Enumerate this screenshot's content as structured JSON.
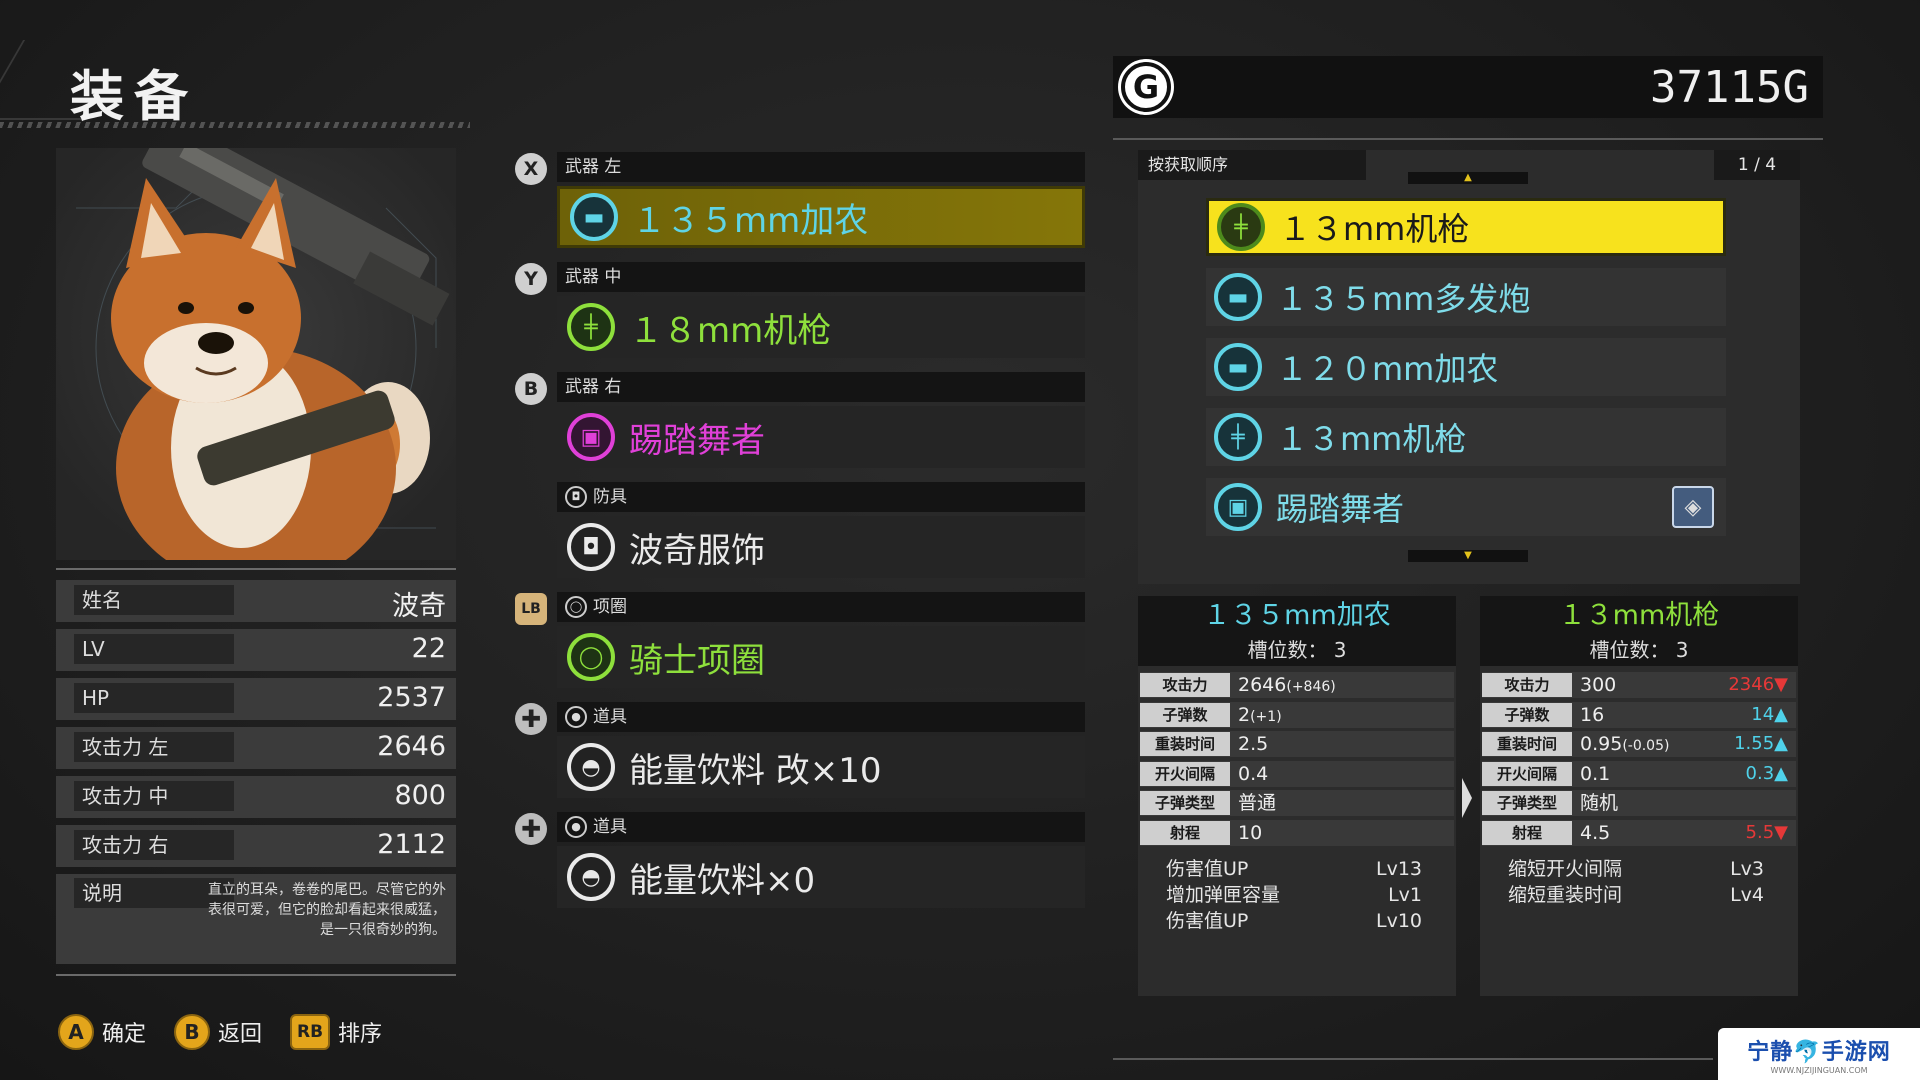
{
  "header": {
    "title": "装备"
  },
  "gold": {
    "amount": "37115G",
    "icon": "G"
  },
  "character": {
    "stats": [
      {
        "label": "姓名",
        "value": "波奇"
      },
      {
        "label": "LV",
        "value": "22"
      },
      {
        "label": "HP",
        "value": "2537"
      },
      {
        "label": "攻击力 左",
        "value": "2646"
      },
      {
        "label": "攻击力 中",
        "value": "800"
      },
      {
        "label": "攻击力 右",
        "value": "2112"
      }
    ],
    "description_label": "说明",
    "description": "直立的耳朵，卷卷的尾巴。尽管它的外表很可爱，但它的脸却看起来很威猛，是一只很奇妙的狗。"
  },
  "slots": [
    {
      "key": "X",
      "category": "武器 左",
      "item": "１３５mm加农",
      "icon": "cannon-icon",
      "color": "#5fd4e6"
    },
    {
      "key": "Y",
      "category": "武器 中",
      "item": "１８mm机枪",
      "icon": "machine-gun-icon",
      "color": "#8ee03c"
    },
    {
      "key": "B",
      "category": "武器 右",
      "item": "踢踏舞者",
      "icon": "tap-dancer-icon",
      "color": "#e040d8"
    },
    {
      "key": "",
      "category": "防具",
      "item": "波奇服饰",
      "icon": "armor-icon",
      "color": "#eaeaea"
    },
    {
      "key": "LB",
      "category": "项圈",
      "item": "骑士项圈",
      "icon": "collar-icon",
      "color": "#8ee03c"
    },
    {
      "key": "",
      "category": "道具",
      "item": "能量饮料 改×10",
      "icon": "item-bag-icon",
      "color": "#eaeaea"
    },
    {
      "key": "",
      "category": "道具",
      "item": "能量饮料×0",
      "icon": "item-bag-icon",
      "color": "#eaeaea"
    }
  ],
  "inventory": {
    "sort_label": "按获取顺序",
    "page": "1 / 4",
    "items": [
      {
        "name": "１３mm机枪",
        "icon": "machine-gun-icon",
        "selected": true
      },
      {
        "name": "１３５mm多发炮",
        "icon": "cannon-icon",
        "selected": false
      },
      {
        "name": "１２０mm加农",
        "icon": "cannon-icon",
        "selected": false
      },
      {
        "name": "１３mm机枪",
        "icon": "machine-gun-icon",
        "selected": false
      },
      {
        "name": "踢踏舞者",
        "icon": "tap-dancer-icon",
        "selected": false,
        "badge": "dog-badge-icon"
      }
    ]
  },
  "compare": {
    "current": {
      "name": "１３５mm加农",
      "slot_count": "槽位数： 3",
      "stats": [
        {
          "label": "攻击力",
          "value": "2646",
          "extra": "(+846)",
          "delta": "",
          "dir": ""
        },
        {
          "label": "子弹数",
          "value": "2",
          "extra": "(+1)",
          "delta": "",
          "dir": ""
        },
        {
          "label": "重装时间",
          "value": "2.5",
          "extra": "",
          "delta": "",
          "dir": ""
        },
        {
          "label": "开火间隔",
          "value": "0.4",
          "extra": "",
          "delta": "",
          "dir": ""
        },
        {
          "label": "子弹类型",
          "value": "普通",
          "extra": "",
          "delta": "",
          "dir": ""
        },
        {
          "label": "射程",
          "value": "10",
          "extra": "",
          "delta": "",
          "dir": ""
        }
      ],
      "skills": [
        {
          "name": "伤害值UP",
          "level": "Lv13"
        },
        {
          "name": "增加弹匣容量",
          "level": "Lv1"
        },
        {
          "name": "伤害值UP",
          "level": "Lv10"
        }
      ]
    },
    "candidate": {
      "name": "１３mm机枪",
      "slot_count": "槽位数： 3",
      "stats": [
        {
          "label": "攻击力",
          "value": "300",
          "extra": "",
          "delta": "2346",
          "dir": "down"
        },
        {
          "label": "子弹数",
          "value": "16",
          "extra": "",
          "delta": "14",
          "dir": "up"
        },
        {
          "label": "重装时间",
          "value": "0.95",
          "extra": "(-0.05)",
          "delta": "1.55",
          "dir": "up"
        },
        {
          "label": "开火间隔",
          "value": "0.1",
          "extra": "",
          "delta": "0.3",
          "dir": "up"
        },
        {
          "label": "子弹类型",
          "value": "随机",
          "extra": "",
          "delta": "",
          "dir": ""
        },
        {
          "label": "射程",
          "value": "4.5",
          "extra": "",
          "delta": "5.5",
          "dir": "down"
        }
      ],
      "skills": [
        {
          "name": "缩短开火间隔",
          "level": "Lv3"
        },
        {
          "name": "缩短重装时间",
          "level": "Lv4"
        }
      ]
    }
  },
  "controls": [
    {
      "button": "A",
      "label": "确定"
    },
    {
      "button": "B",
      "label": "返回"
    },
    {
      "button": "RB",
      "label": "排序"
    }
  ],
  "watermark": {
    "name": "宁静🐬手游网",
    "url": "WWW.NJZIJINGUAN.COM"
  },
  "colors": {
    "selected_yellow": "#f7e21d",
    "cyan": "#5fd4e6",
    "green": "#8ee03c",
    "pink": "#e040d8",
    "stat_up": "#4fd2ea",
    "stat_down": "#e63838",
    "button_gold": "#e3a51b"
  }
}
